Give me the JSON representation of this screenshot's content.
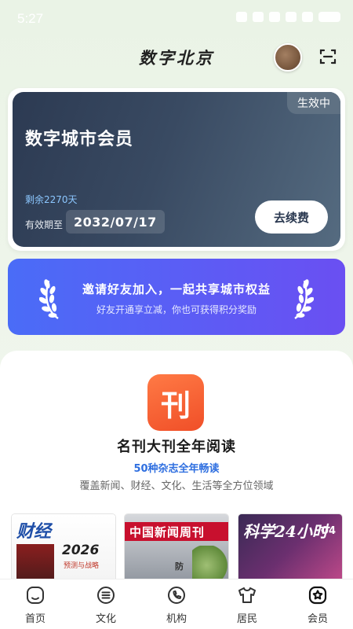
{
  "status_bar": {
    "time": "5:27"
  },
  "header": {
    "title": "数字北京"
  },
  "membership_card": {
    "title": "数字城市会员",
    "status_badge": "生效中",
    "remaining": "剩余2270天",
    "valid_label": "有效期至",
    "valid_date": "2032/07/17",
    "renew_label": "去续费"
  },
  "invite_banner": {
    "title": "邀请好友加入，一起共享城市权益",
    "subtitle": "好友开通享立减，你也可获得积分奖励"
  },
  "magazine_promo": {
    "icon_glyph": "刊",
    "title": "名刊大刊全年阅读",
    "subtitle": "50种杂志全年畅读",
    "description": "覆盖新闻、财经、文化、生活等全方位领域",
    "covers": [
      {
        "title": "财经",
        "year": "2026",
        "sub": "预测与战略"
      },
      {
        "title": "中国新闻周刊",
        "side_text": "防"
      },
      {
        "title": "科学24小时",
        "issue": "04"
      }
    ]
  },
  "bottom_nav": {
    "items": [
      {
        "label": "首页",
        "icon": "home-icon"
      },
      {
        "label": "文化",
        "icon": "list-icon"
      },
      {
        "label": "机构",
        "icon": "phone-icon"
      },
      {
        "label": "居民",
        "icon": "shirt-icon"
      },
      {
        "label": "会员",
        "icon": "star-icon"
      }
    ]
  },
  "colors": {
    "card_gradient_start": "#2c3a52",
    "card_gradient_end": "#556b80",
    "banner_gradient_start": "#4a6cf7",
    "banner_gradient_end": "#6a4ff2",
    "accent_blue": "#2f6fe0",
    "magazine_icon": "#f04f28"
  }
}
